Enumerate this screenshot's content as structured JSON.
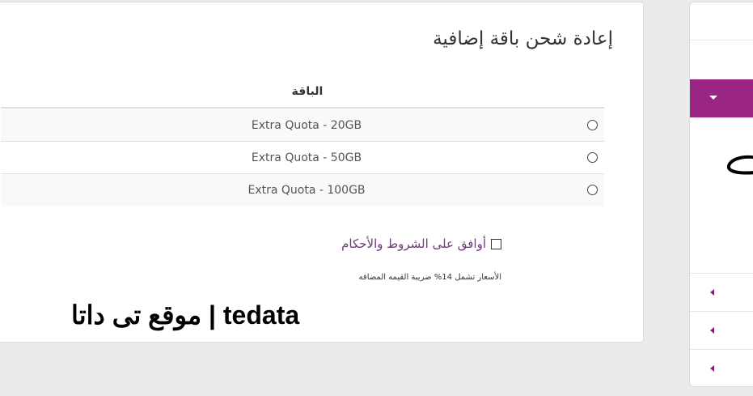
{
  "page": {
    "title": "إعادة شحن باقة إضافية"
  },
  "table": {
    "column_header": "الباقة",
    "rows": [
      {
        "name": "Extra Quota - 20GB"
      },
      {
        "name": "Extra Quota - 50GB"
      },
      {
        "name": "Extra Quota - 100GB"
      }
    ]
  },
  "terms": {
    "label": "أوافق على الشروط والأحكام"
  },
  "vat_note": "الأسعار تشمل 14% ضريبة القيمه المضافه",
  "watermark": "tedata | موقع تى داتا",
  "colors": {
    "accent": "#9b2583",
    "link": "#6d3a78"
  }
}
